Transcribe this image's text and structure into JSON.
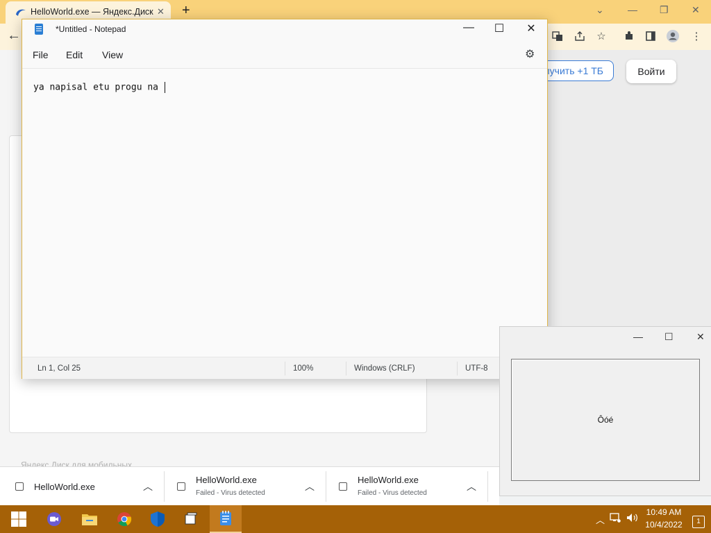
{
  "browser": {
    "tab_title": "HelloWorld.exe — Яндекс.Диск",
    "tab_close": "✕",
    "new_tab": "+",
    "back": "←",
    "upgrade_label": "лучить +1 ТБ",
    "login_label": "Войти",
    "footer_text": "Яндекс.Диск для мобильных"
  },
  "notepad": {
    "title": "*Untitled - Notepad",
    "menu": [
      "File",
      "Edit",
      "View"
    ],
    "content": "ya napisal etu progu na ",
    "status": {
      "position": "Ln 1, Col 25",
      "zoom": "100%",
      "line_ending": "Windows (CRLF)",
      "encoding": "UTF-8"
    }
  },
  "dialog": {
    "text": "Ôóé"
  },
  "downloads": [
    {
      "name": "HelloWorld.exe",
      "status": ""
    },
    {
      "name": "HelloWorld.exe",
      "status": "Failed - Virus detected"
    },
    {
      "name": "HelloWorld.exe",
      "status": "Failed - Virus detected"
    }
  ],
  "taskbar": {
    "time": "10:49 AM",
    "date": "10/4/2022",
    "notification_count": "1"
  },
  "colors": {
    "accent": "#e0b64a",
    "taskbar": "#a56107",
    "link_blue": "#3a7bd5"
  }
}
